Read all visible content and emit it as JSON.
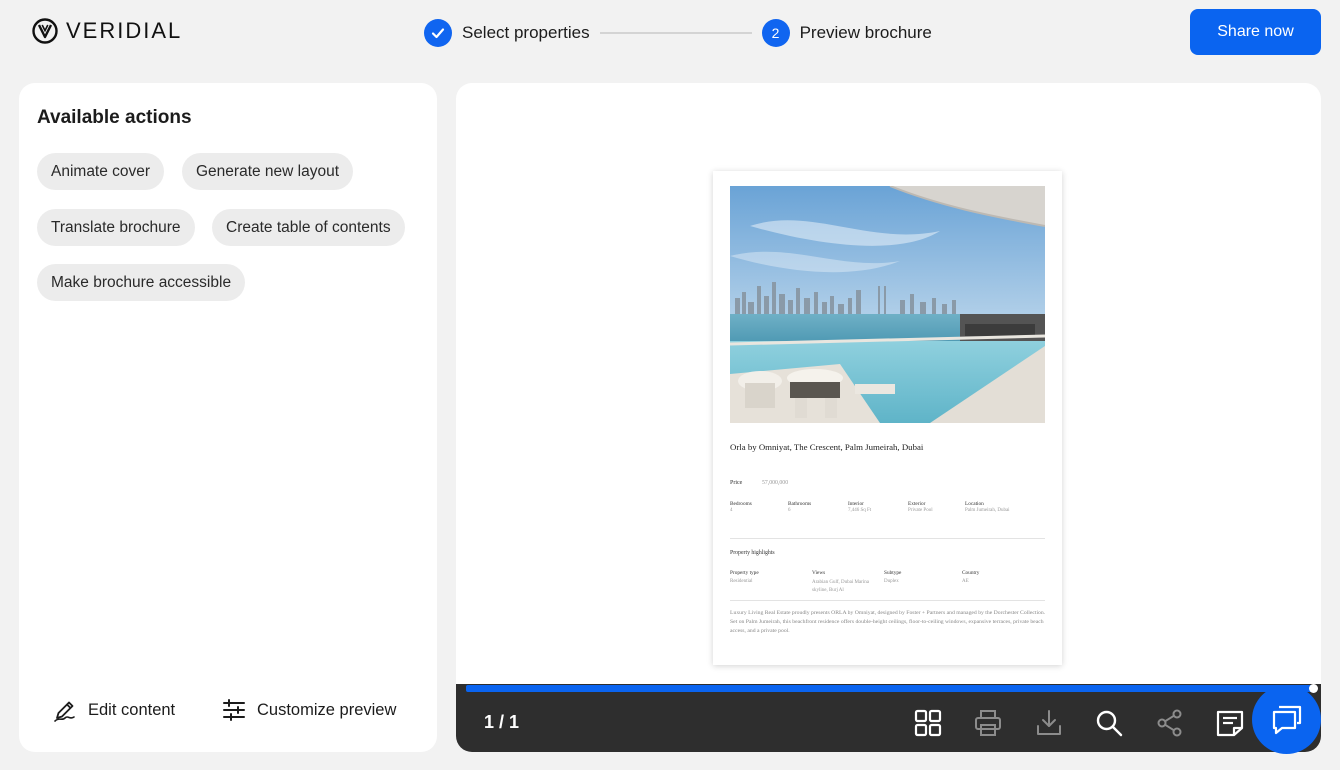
{
  "header": {
    "logo_text": "VERIDIAL",
    "steps": [
      {
        "number": "✓",
        "label": "Select properties",
        "state": "completed"
      },
      {
        "number": "2",
        "label": "Preview brochure",
        "state": "active"
      }
    ],
    "share_label": "Share now"
  },
  "actions_panel": {
    "title": "Available actions",
    "chips": [
      "Animate cover",
      "Generate new layout",
      "Translate brochure",
      "Create table of contents",
      "Make brochure accessible"
    ],
    "edit_label": "Edit content",
    "customize_label": "Customize preview"
  },
  "brochure": {
    "title": "Orla by Omniyat, The Crescent, Palm Jumeirah, Dubai",
    "price_label": "Price",
    "price_value": "57,000,000",
    "specs": [
      {
        "label": "Bedrooms",
        "value": "4"
      },
      {
        "label": "Bathrooms",
        "value": "6"
      },
      {
        "label": "Interior",
        "value": "7,446 Sq Ft"
      },
      {
        "label": "Exterior",
        "value": "Private Pool"
      },
      {
        "label": "Location",
        "value": "Palm Jumeirah, Dubai"
      }
    ],
    "highlights_title": "Property highlights",
    "highlights": [
      {
        "label": "Property type",
        "value": "Residential"
      },
      {
        "label": "Views",
        "value": "Arabian Gulf, Dubai Marina skyline, Burj Al"
      },
      {
        "label": "Subtype",
        "value": "Duplex"
      },
      {
        "label": "Country",
        "value": "AE"
      }
    ],
    "description": "Luxury Living Real Estate proudly presents ORLA by Omniyat, designed by Foster + Partners and managed by the Dorchester Collection. Set on Palm Jumeirah, this beachfront residence offers double-height ceilings, floor-to-ceiling windows, expansive terraces, private beach access, and a private pool."
  },
  "viewer": {
    "page_indicator": "1 / 1",
    "progress": 1.0,
    "tools": [
      "grid-icon",
      "print-icon",
      "download-icon",
      "search-icon",
      "share-icon",
      "notes-icon"
    ]
  },
  "colors": {
    "accent": "#0a64f0",
    "toolbar_bg": "#2e2e2e",
    "chip_bg": "#ececec",
    "page_bg": "#f2f2f2"
  }
}
